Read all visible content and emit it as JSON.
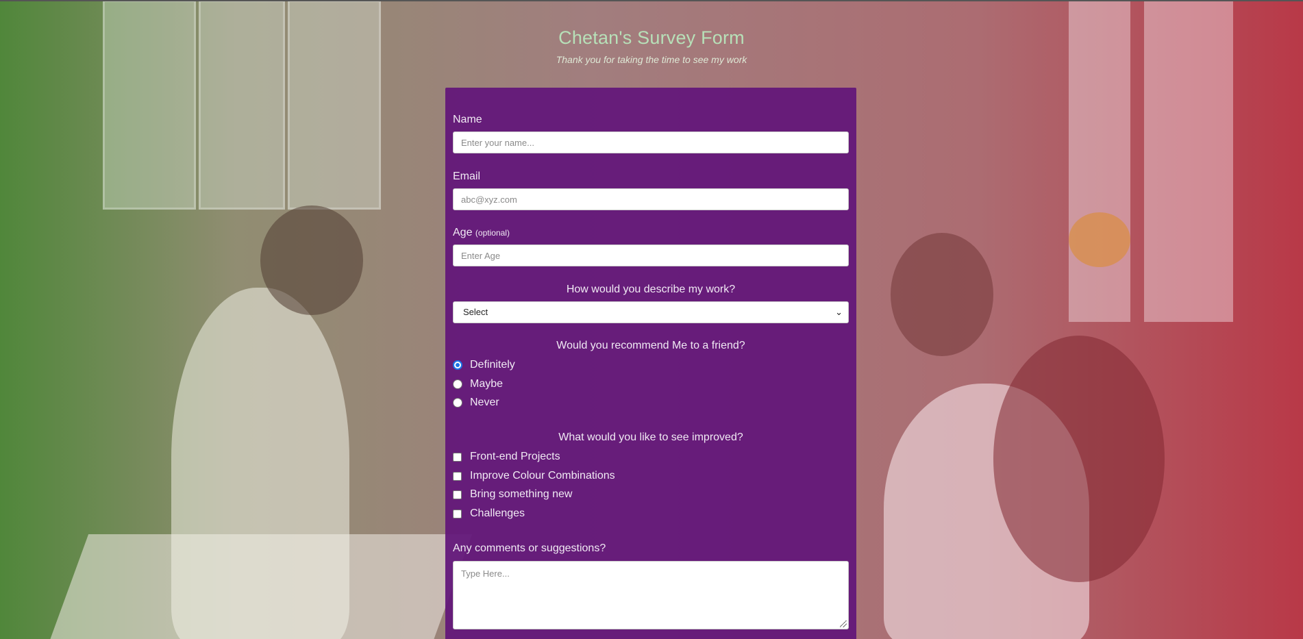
{
  "header": {
    "title": "Chetan's Survey Form",
    "subtitle": "Thank you for taking the time to see my work"
  },
  "form": {
    "name": {
      "label": "Name",
      "placeholder": "Enter your name..."
    },
    "email": {
      "label": "Email",
      "placeholder": "abc@xyz.com"
    },
    "age": {
      "label": "Age",
      "hint": "(optional)",
      "placeholder": "Enter Age"
    },
    "describe": {
      "label": "How would you describe my work?",
      "selected": "Select"
    },
    "recommend": {
      "label": "Would you recommend Me to a friend?",
      "options": [
        "Definitely",
        "Maybe",
        "Never"
      ],
      "selected": "Definitely"
    },
    "improve": {
      "label": "What would you like to see improved?",
      "options": [
        "Front-end Projects",
        "Improve Colour Combinations",
        "Bring something new",
        "Challenges"
      ]
    },
    "comments": {
      "label": "Any comments or suggestions?",
      "placeholder": "Type Here..."
    }
  },
  "colors": {
    "form_bg": "#62167a",
    "title": "#b7e0b8",
    "radio_accent": "#1a73e8"
  }
}
